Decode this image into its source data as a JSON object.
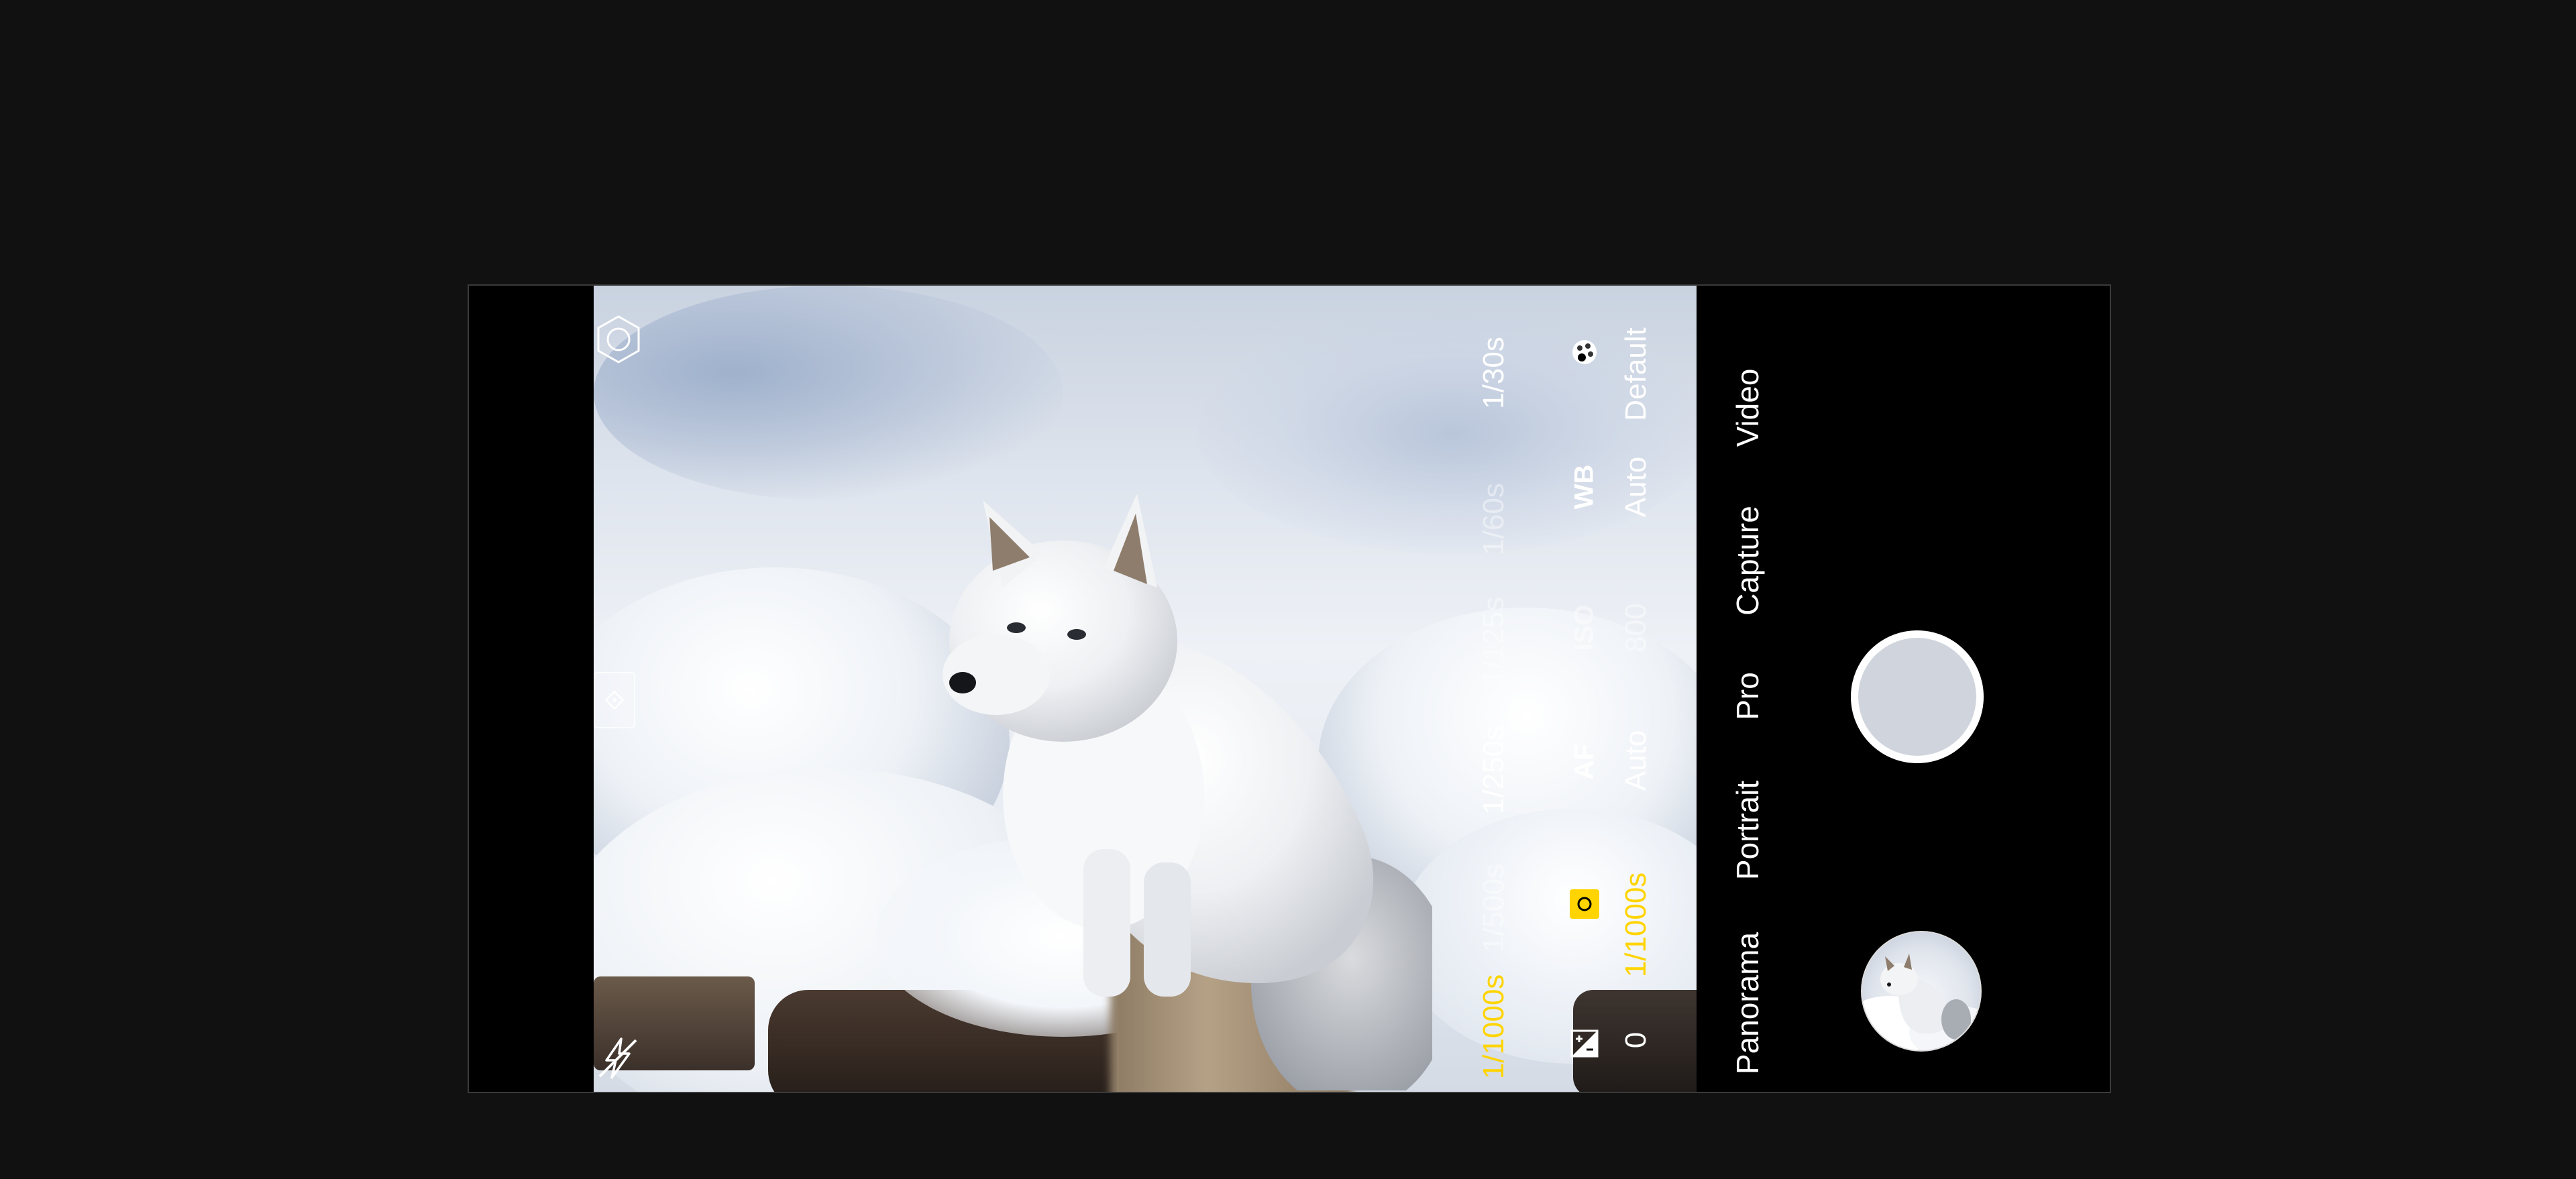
{
  "viewfinder": {
    "scene": "arctic-fox-in-snow",
    "accent_color": "#ffd400"
  },
  "controls": {
    "shutter_options": [
      "1/1000s",
      "1/500s",
      "1/250s",
      "1/125s",
      "1/60s",
      "1/30s"
    ],
    "shutter_selected_index": 0,
    "params": [
      {
        "icon": "exposure-compensation-icon",
        "value": "0"
      },
      {
        "icon": "shutter-speed-icon",
        "value": "1/1000s"
      },
      {
        "label": "AF",
        "value": "Auto"
      },
      {
        "label": "ISO",
        "value": "800"
      },
      {
        "label": "WB",
        "value": "Auto"
      },
      {
        "icon": "color-profile-icon",
        "value": "Default"
      }
    ]
  },
  "modes": {
    "items": [
      "Panorama",
      "Portrait",
      "Pro",
      "Capture",
      "Video"
    ],
    "selected": "Pro"
  },
  "icons": {
    "settings": "hexagon-settings-icon",
    "focus_lock": "focus-lock-icon",
    "flash": "flash-off-icon",
    "shutter": "shutter-button",
    "gallery": "gallery-thumbnail"
  }
}
